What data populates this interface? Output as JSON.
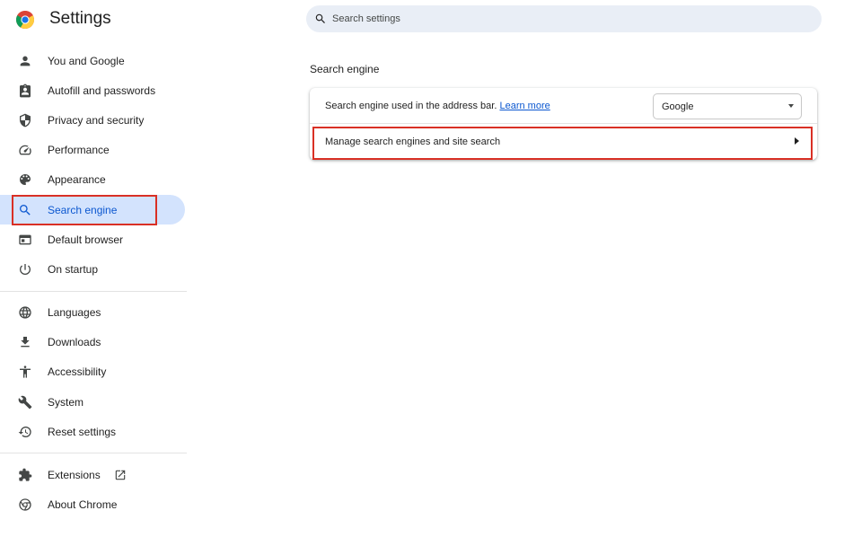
{
  "header": {
    "title": "Settings",
    "search_placeholder": "Search settings"
  },
  "sidebar": {
    "items": [
      {
        "label": "You and Google",
        "icon": "person-icon"
      },
      {
        "label": "Autofill and passwords",
        "icon": "clipboard-icon"
      },
      {
        "label": "Privacy and security",
        "icon": "shield-icon"
      },
      {
        "label": "Performance",
        "icon": "speedometer-icon"
      },
      {
        "label": "Appearance",
        "icon": "palette-icon"
      },
      {
        "label": "Search engine",
        "icon": "search-icon",
        "active": true
      },
      {
        "label": "Default browser",
        "icon": "browser-window-icon"
      },
      {
        "label": "On startup",
        "icon": "power-icon"
      }
    ],
    "items2": [
      {
        "label": "Languages",
        "icon": "globe-icon"
      },
      {
        "label": "Downloads",
        "icon": "download-icon"
      },
      {
        "label": "Accessibility",
        "icon": "accessibility-icon"
      },
      {
        "label": "System",
        "icon": "wrench-icon"
      },
      {
        "label": "Reset settings",
        "icon": "history-icon"
      }
    ],
    "items3": [
      {
        "label": "Extensions",
        "icon": "puzzle-icon"
      },
      {
        "label": "About Chrome",
        "icon": "chrome-icon"
      }
    ]
  },
  "main": {
    "section_title": "Search engine",
    "address_bar_label": "Search engine used in the address bar.",
    "learn_more": "Learn more",
    "engine_selected": "Google",
    "manage_label": "Manage search engines and site search"
  },
  "colors": {
    "accent": "#0b57d0",
    "active_bg": "#d3e3fd",
    "highlight": "#d93025",
    "search_bg": "#e9eef6"
  }
}
